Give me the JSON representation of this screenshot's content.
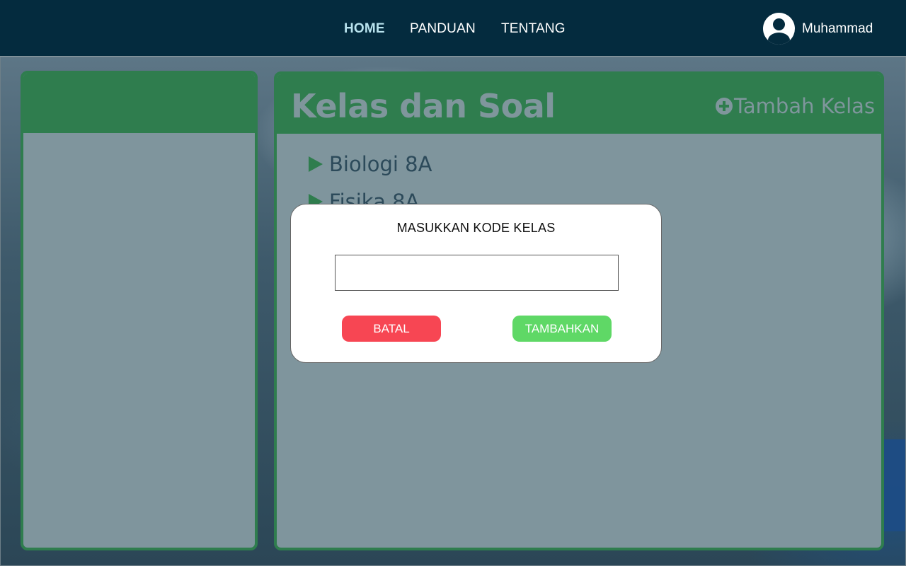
{
  "nav": {
    "items": [
      {
        "label": "HOME",
        "active": true
      },
      {
        "label": "PANDUAN",
        "active": false
      },
      {
        "label": "TENTANG",
        "active": false
      }
    ]
  },
  "user": {
    "name": "Muhammad",
    "icon": "user-avatar-icon"
  },
  "main": {
    "title": "Kelas dan Soal",
    "add_class_label": "Tambah Kelas",
    "add_class_icon": "plus-circle-icon",
    "classes": [
      {
        "label": "Biologi 8A",
        "icon": "triangle-right-icon"
      },
      {
        "label": "Fisika 8A",
        "icon": "triangle-right-icon"
      }
    ]
  },
  "modal": {
    "title": "MASUKKAN KODE KELAS",
    "input_value": "",
    "cancel_label": "BATAL",
    "submit_label": "TAMBAHKAN"
  },
  "colors": {
    "topbar": "#042b3e",
    "panel_border": "#2f7d4e",
    "panel_bg": "#7f959d",
    "cancel": "#f74653",
    "submit": "#5fd866",
    "nav_active": "#b9e3ee"
  }
}
